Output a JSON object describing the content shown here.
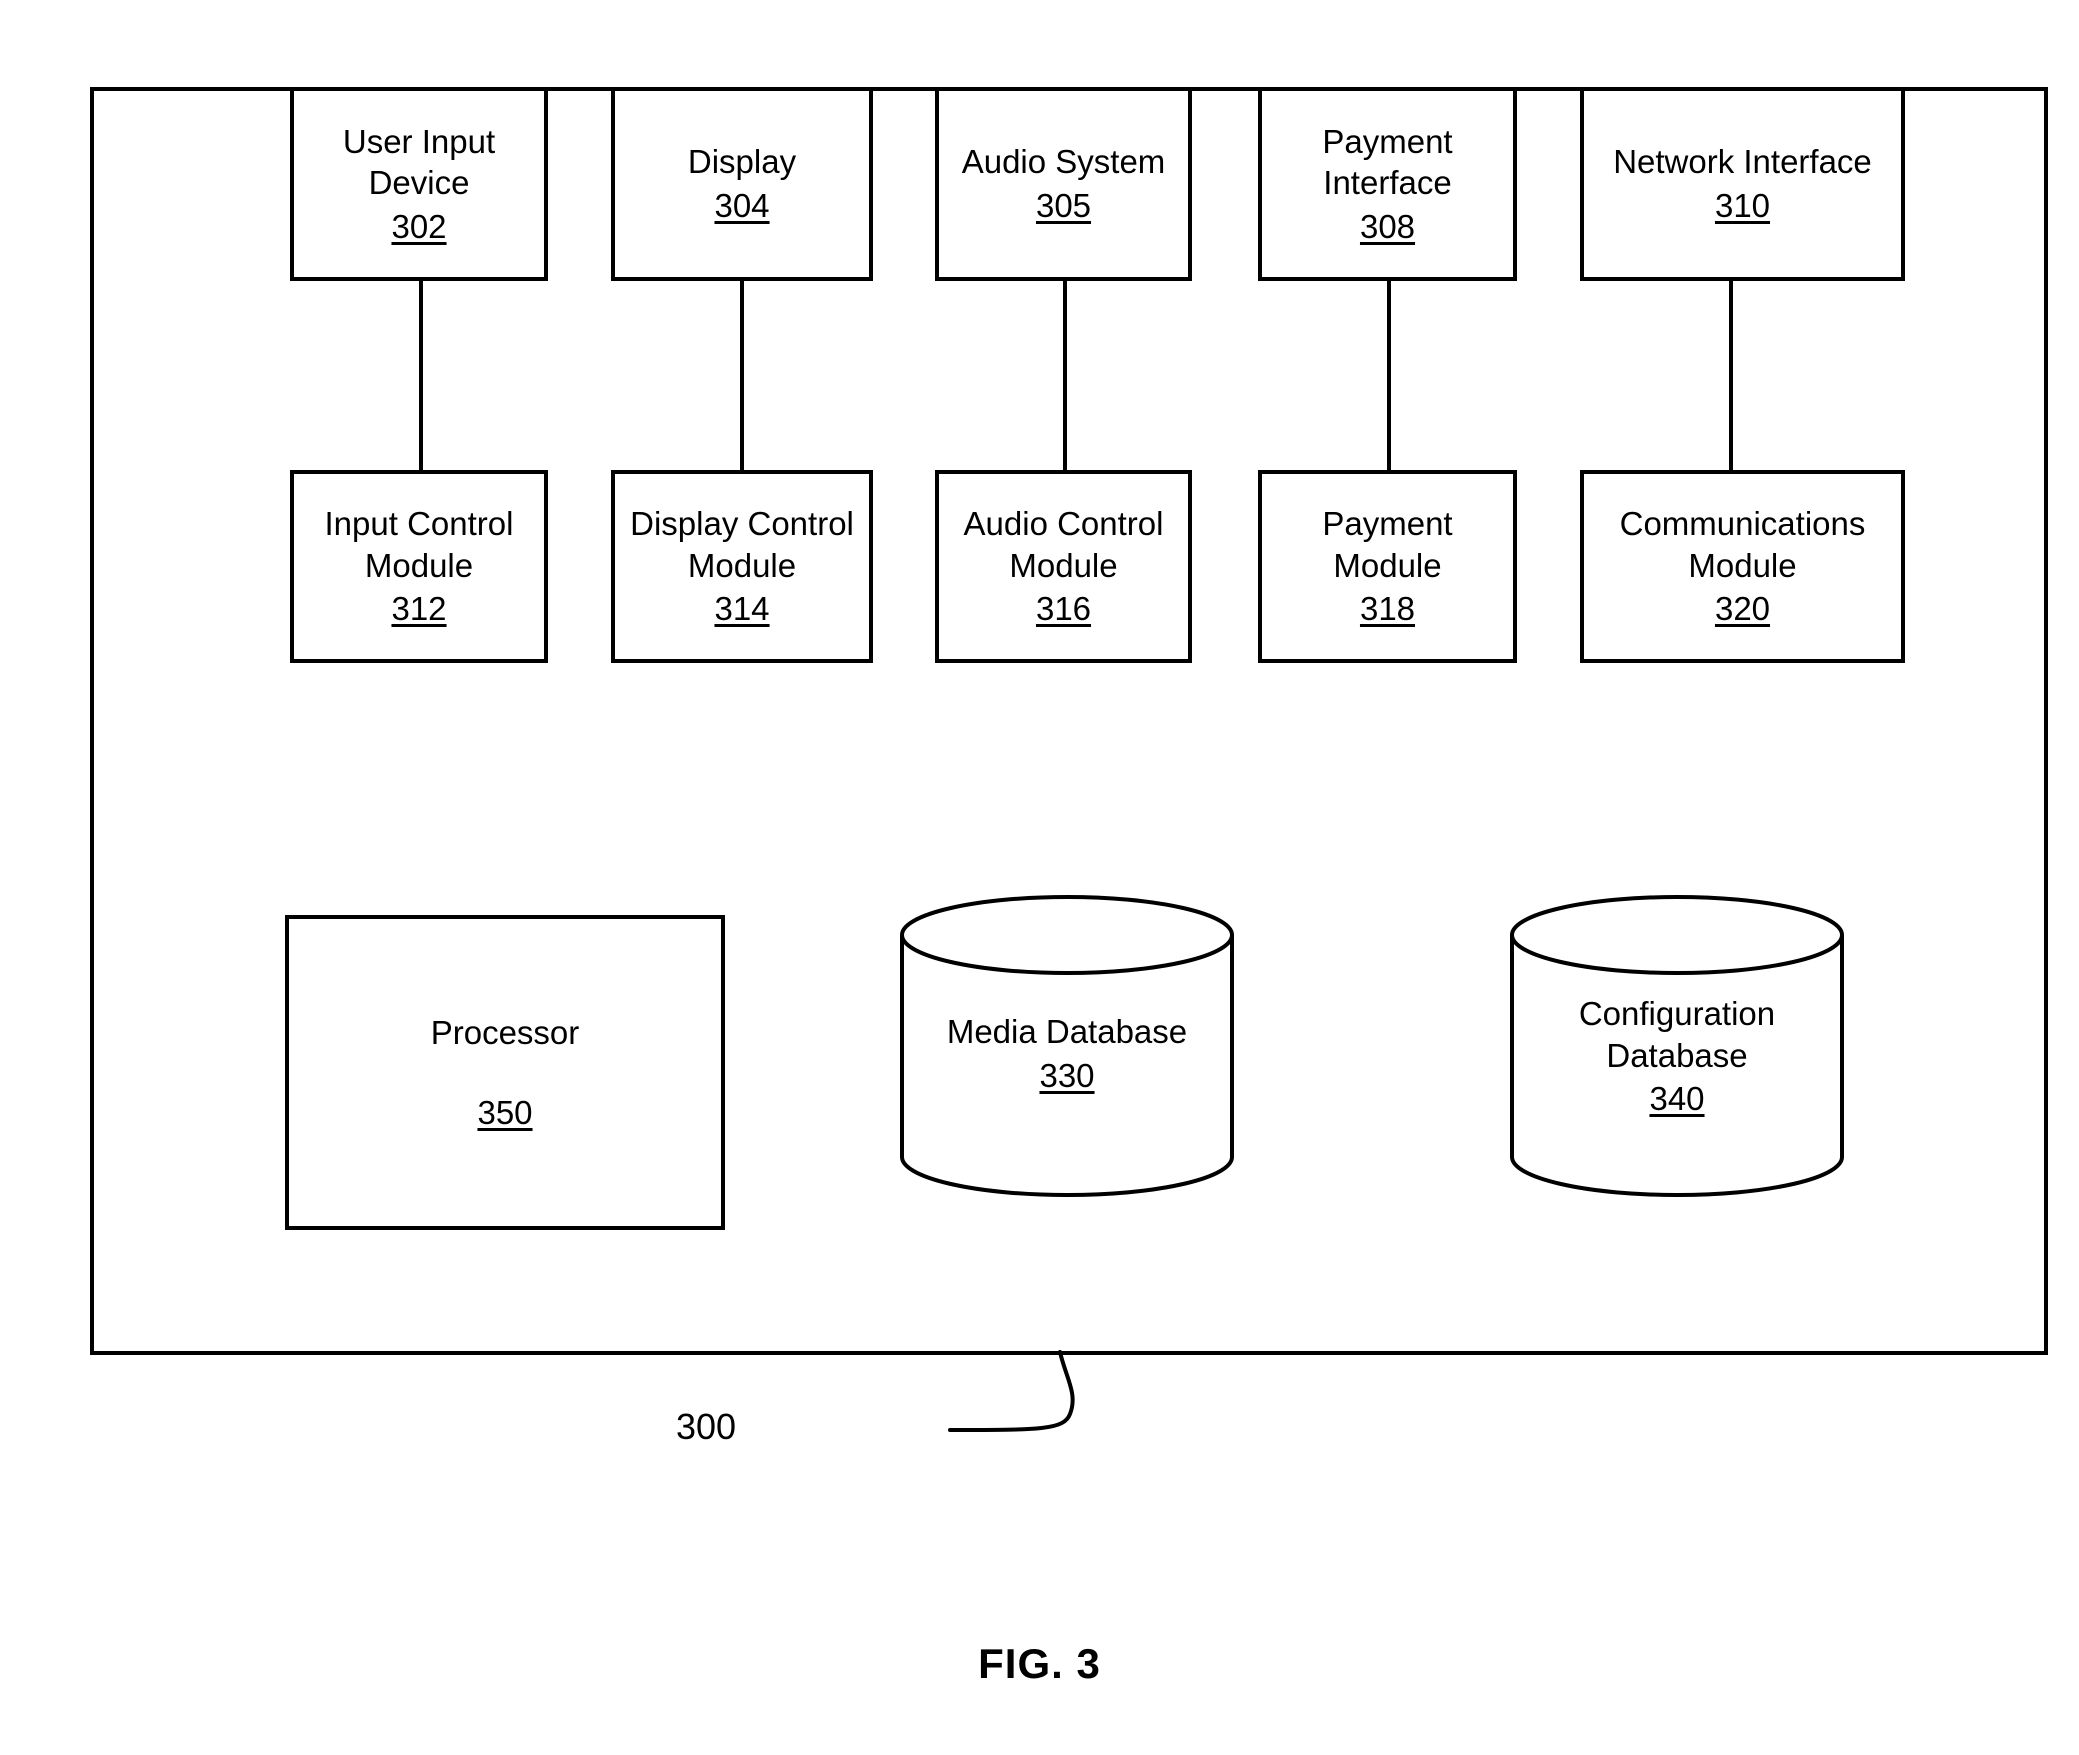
{
  "figure": {
    "caption": "FIG. 3",
    "system_ref": "300"
  },
  "devices": [
    {
      "label": "User Input\nDevice",
      "ref": "302",
      "name": "user-input-device"
    },
    {
      "label": "Display",
      "ref": "304",
      "name": "display"
    },
    {
      "label": "Audio System",
      "ref": "305",
      "name": "audio-system"
    },
    {
      "label": "Payment\nInterface",
      "ref": "308",
      "name": "payment-interface"
    },
    {
      "label": "Network Interface",
      "ref": "310",
      "name": "network-interface"
    }
  ],
  "modules": [
    {
      "label": "Input Control\nModule",
      "ref": "312",
      "name": "input-control-module"
    },
    {
      "label": "Display Control\nModule",
      "ref": "314",
      "name": "display-control-module"
    },
    {
      "label": "Audio Control\nModule",
      "ref": "316",
      "name": "audio-control-module"
    },
    {
      "label": "Payment\nModule",
      "ref": "318",
      "name": "payment-module"
    },
    {
      "label": "Communications\nModule",
      "ref": "320",
      "name": "communications-module"
    }
  ],
  "processor": {
    "label": "Processor",
    "ref": "350"
  },
  "databases": [
    {
      "label": "Media Database",
      "ref": "330",
      "name": "media-database"
    },
    {
      "label": "Configuration\nDatabase",
      "ref": "340",
      "name": "configuration-database"
    }
  ]
}
